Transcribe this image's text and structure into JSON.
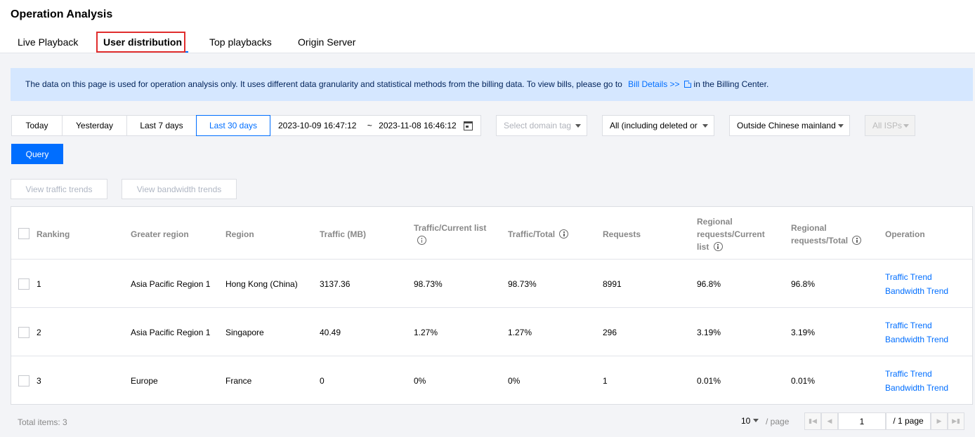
{
  "header": {
    "title": "Operation Analysis",
    "tabs": [
      {
        "label": "Live Playback"
      },
      {
        "label": "User distribution"
      },
      {
        "label": "Top playbacks"
      },
      {
        "label": "Origin Server"
      }
    ],
    "active_tab": "User distribution",
    "highlight_color": "#e02d2d"
  },
  "notice": {
    "text_before": "The data on this page is used for operation analysis only. It uses different data granularity and statistical methods from the billing data. To view bills, please go to",
    "link_text": "Bill Details >>",
    "text_after": "in the Billing Center.",
    "icon": "external-link-icon"
  },
  "filters": {
    "time_ranges": [
      "Today",
      "Yesterday",
      "Last 7 days",
      "Last 30 days"
    ],
    "active_time_range": "Last 30 days",
    "date_start": "2023-10-09 16:47:12",
    "date_separator": "~",
    "date_end": "2023-11-08 16:46:12",
    "domain_tag_placeholder": "Select domain tag",
    "domain_scope": "All (including deleted or",
    "region_scope": "Outside Chinese mainland",
    "isp": "All ISPs",
    "query_label": "Query"
  },
  "actions": {
    "view_traffic_trends": "View traffic trends",
    "view_bandwidth_trends": "View bandwidth trends"
  },
  "table": {
    "columns": {
      "ranking": "Ranking",
      "greater_region": "Greater region",
      "region": "Region",
      "traffic": "Traffic (MB)",
      "traffic_current_list": "Traffic/Current list",
      "traffic_total": "Traffic/Total",
      "requests": "Requests",
      "regional_requests_current_list_1": "Regional",
      "regional_requests_current_list_2": "requests/Current",
      "regional_requests_current_list_3": "list",
      "regional_requests_total_1": "Regional",
      "regional_requests_total_2": "requests/Total",
      "operation": "Operation"
    },
    "rows": [
      {
        "ranking": "1",
        "greater_region": "Asia Pacific Region 1",
        "region": "Hong Kong (China)",
        "traffic": "3137.36",
        "traffic_current": "98.73%",
        "traffic_total": "98.73%",
        "requests": "8991",
        "req_current": "96.8%",
        "req_total": "96.8%",
        "op1": "Traffic Trend",
        "op2": "Bandwidth Trend"
      },
      {
        "ranking": "2",
        "greater_region": "Asia Pacific Region 1",
        "region": "Singapore",
        "traffic": "40.49",
        "traffic_current": "1.27%",
        "traffic_total": "1.27%",
        "requests": "296",
        "req_current": "3.19%",
        "req_total": "3.19%",
        "op1": "Traffic Trend",
        "op2": "Bandwidth Trend"
      },
      {
        "ranking": "3",
        "greater_region": "Europe",
        "region": "France",
        "traffic": "0",
        "traffic_current": "0%",
        "traffic_total": "0%",
        "requests": "1",
        "req_current": "0.01%",
        "req_total": "0.01%",
        "op1": "Traffic Trend",
        "op2": "Bandwidth Trend"
      }
    ]
  },
  "pagination": {
    "total_items": "Total items: 3",
    "page_size": "10",
    "per_page": "/ page",
    "current_page": "1",
    "total_pages": "/ 1 page"
  },
  "colors": {
    "primary": "#006eff",
    "notice_bg": "#d5e7ff"
  }
}
